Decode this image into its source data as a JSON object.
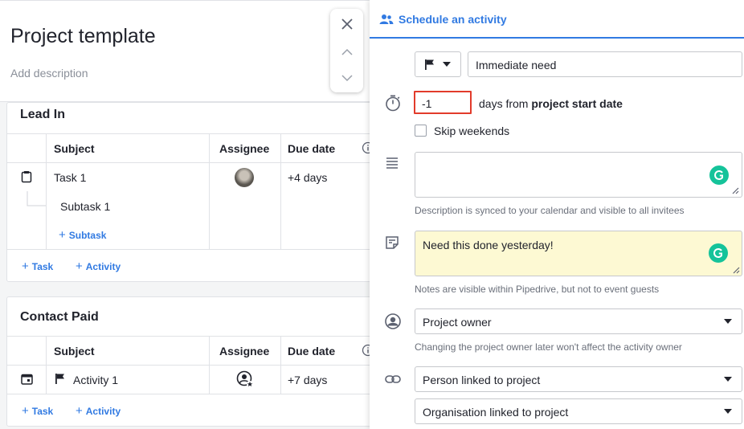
{
  "page": {
    "title": "Project template",
    "description_placeholder": "Add description"
  },
  "sections": [
    {
      "title": "Lead In",
      "columns": [
        "Subject",
        "Assignee",
        "Due date"
      ],
      "rows": [
        {
          "subject": "Task 1",
          "due": "+4 days"
        },
        {
          "subject": "Subtask 1"
        }
      ],
      "add_subtask": "Subtask",
      "add_task": "Task",
      "add_activity": "Activity"
    },
    {
      "title": "Contact Paid",
      "columns": [
        "Subject",
        "Assignee",
        "Due date"
      ],
      "rows": [
        {
          "subject": "Activity 1",
          "due": "+7 days"
        }
      ],
      "add_task": "Task",
      "add_activity": "Activity"
    }
  ],
  "panel": {
    "tab": "Schedule an activity",
    "subject_value": "Immediate need",
    "offset_value": "-1",
    "offset_prefix": "days from",
    "offset_anchor": "project start date",
    "skip_weekends": "Skip weekends",
    "skip_weekends_checked": false,
    "description_value": "",
    "description_hint": "Description is synced to your calendar and visible to all invitees",
    "note_value": "Need this done yesterday!",
    "note_hint": "Notes are visible within Pipedrive, but not to event guests",
    "owner_value": "Project owner",
    "owner_hint": "Changing the project owner later won't affect the activity owner",
    "person_value": "Person linked to project",
    "org_value": "Organisation linked to project"
  },
  "colors": {
    "accent": "#317ae2",
    "highlight": "#e23b2b",
    "note_bg": "#fdf9d3",
    "grammarly": "#15c39a"
  },
  "icons": [
    "close-icon",
    "chevron-up-icon",
    "chevron-down-icon",
    "people-icon",
    "flag-icon",
    "timer-icon",
    "lines-icon",
    "note-icon",
    "user-circle-icon",
    "link-icon",
    "clipboard-icon",
    "calendar-icon",
    "info-icon",
    "user-star-icon"
  ]
}
